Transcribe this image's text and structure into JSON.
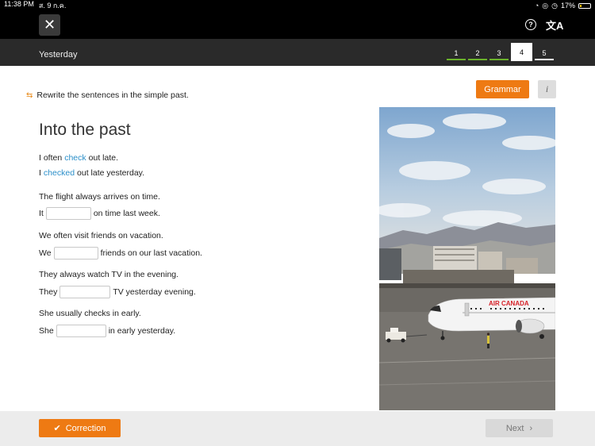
{
  "status": {
    "time": "11:38 PM",
    "date": "ส. 9 ก.ค.",
    "battery": "17%",
    "battery_level": 0.17
  },
  "header": {
    "close_icon": "close-icon",
    "help_icon": "help-icon",
    "translate_icon": "translate-icon"
  },
  "lesson": {
    "title": "Yesterday",
    "steps": [
      "1",
      "2",
      "3",
      "4",
      "5"
    ],
    "active_step": 4
  },
  "exercise": {
    "instruction": "Rewrite the sentences in the simple past.",
    "grammar_label": "Grammar",
    "info_label": "i",
    "title": "Into the past",
    "example": {
      "prompt_a": "I often",
      "prompt_word": "check",
      "prompt_b": "out late.",
      "answer_a": "I",
      "answer_word": "checked",
      "answer_b": "out late yesterday."
    },
    "items": [
      {
        "prompt": "The flight always arrives on time.",
        "before": "It",
        "after": "on time last week.",
        "value": ""
      },
      {
        "prompt": "We often visit friends on vacation.",
        "before": "We",
        "after": "friends on our last vacation.",
        "value": ""
      },
      {
        "prompt": "They always watch TV in the evening.",
        "before": "They",
        "after": "TV yesterday evening.",
        "value": ""
      },
      {
        "prompt": "She usually checks in early.",
        "before": "She",
        "after": "in early yesterday.",
        "value": ""
      }
    ]
  },
  "photo": {
    "plane_livery": "AIR CANADA"
  },
  "footer": {
    "correction_label": "Correction",
    "next_label": "Next"
  },
  "colors": {
    "accent": "#ee7a13",
    "link": "#2b8fc9",
    "step_done": "#6bb22c"
  }
}
